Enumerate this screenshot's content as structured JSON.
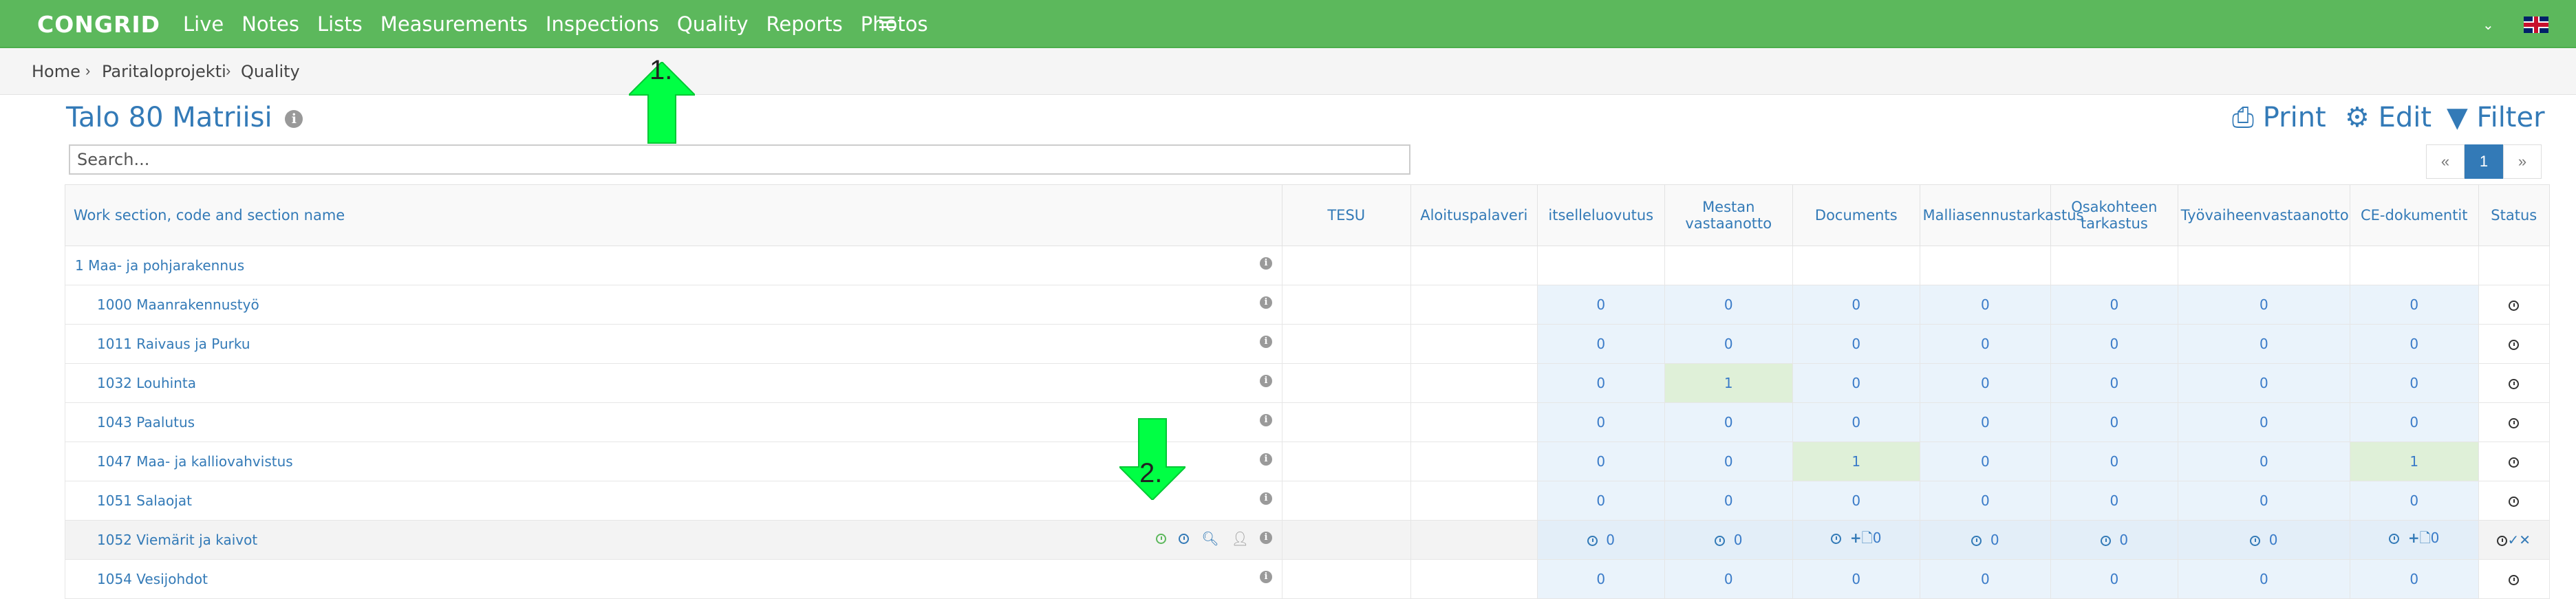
{
  "app": {
    "logo": "CONGRID",
    "nav": [
      "Live",
      "Notes",
      "Lists",
      "Measurements",
      "Inspections",
      "Quality",
      "Reports",
      "Photos"
    ]
  },
  "breadcrumb": {
    "home": "Home",
    "project": "Paritaloprojekti",
    "current": "Quality"
  },
  "page": {
    "title": "Talo 80 Matriisi",
    "print_label": "Print",
    "edit_label": "Edit",
    "filter_label": "Filter",
    "search_placeholder": "Search..."
  },
  "pager": {
    "prev": "«",
    "page": "1",
    "next": "»"
  },
  "table": {
    "headers": [
      "Work section, code and section name",
      "TESU",
      "Aloituspalaveri",
      "itselleluovutus",
      "Mestan vastaanotto",
      "Documents",
      "Malliasennustarkastus",
      "Osakohteen tarkastus",
      "Työvaiheenvastaanotto",
      "CE-dokumentit",
      "Status"
    ],
    "rows": [
      {
        "name": "1 Maa- ja pohjarakennus"
      },
      {
        "name": "1000 Maanrakennustyö",
        "v": [
          "0",
          "0",
          "0",
          "0",
          "0",
          "0",
          "0"
        ]
      },
      {
        "name": "1011 Raivaus ja Purku",
        "v": [
          "0",
          "0",
          "0",
          "0",
          "0",
          "0",
          "0"
        ]
      },
      {
        "name": "1032 Louhinta",
        "v": [
          "0",
          "1",
          "0",
          "0",
          "0",
          "0",
          "0"
        ]
      },
      {
        "name": "1043 Paalutus",
        "v": [
          "0",
          "0",
          "0",
          "0",
          "0",
          "0",
          "0"
        ]
      },
      {
        "name": "1047 Maa- ja kalliovahvistus",
        "v": [
          "0",
          "0",
          "1",
          "0",
          "0",
          "0",
          "1"
        ]
      },
      {
        "name": "1051 Salaojat",
        "v": [
          "0",
          "0",
          "0",
          "0",
          "0",
          "0",
          "0"
        ]
      },
      {
        "name": "1052 Viemärit ja kaivot",
        "v": [
          "0",
          "0",
          "0",
          "0",
          "0",
          "0",
          "0"
        ]
      },
      {
        "name": "1054 Vesijohdot",
        "v": [
          "0",
          "0",
          "0",
          "0",
          "0",
          "0",
          "0"
        ]
      }
    ]
  },
  "annotations": {
    "step1": "1.",
    "step2": "2."
  },
  "colors": {
    "topbar": "#5cb85c",
    "link": "#337ab7",
    "arrow": "#00ff44"
  }
}
